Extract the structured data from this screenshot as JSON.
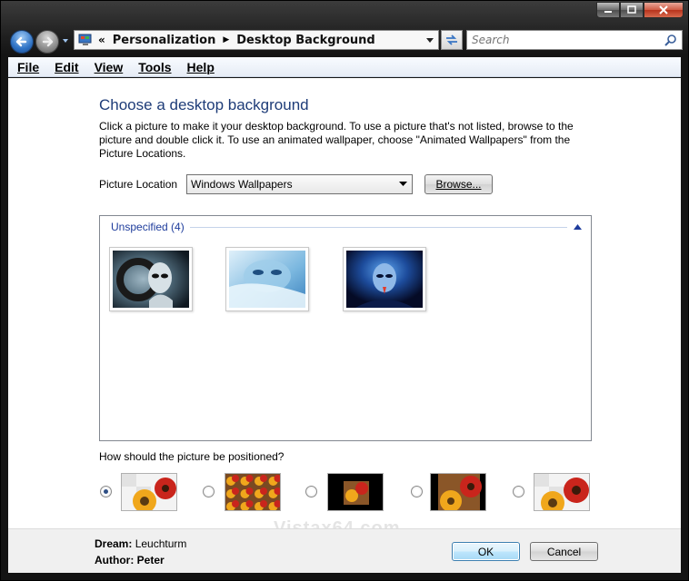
{
  "address": {
    "crumbs": [
      "Personalization",
      "Desktop Background"
    ]
  },
  "search": {
    "placeholder": "Search"
  },
  "menu": [
    "File",
    "Edit",
    "View",
    "Tools",
    "Help"
  ],
  "page": {
    "title": "Choose a desktop background",
    "description": "Click a picture to make it your desktop background. To use a picture that's not listed, browse to the picture and double click it. To use an animated wallpaper, choose \"Animated Wallpapers\" from the Picture Locations.",
    "location_label": "Picture Location",
    "location_value": "Windows Wallpapers",
    "browse_label": "Browse...",
    "group_label": "Unspecified (4)",
    "position_question": "How should the picture be positioned?",
    "selected_position_index": 0
  },
  "watermark": "Vistax64.com",
  "footer": {
    "name_label": "Dream:",
    "name_value": "Leuchturm",
    "author_label": "Author:",
    "author_value": "Peter",
    "ok_label": "OK",
    "cancel_label": "Cancel"
  },
  "colors": {
    "heading": "#1e3c78",
    "group_label": "#1e3c9c",
    "ok_border": "#3c7fb1"
  }
}
